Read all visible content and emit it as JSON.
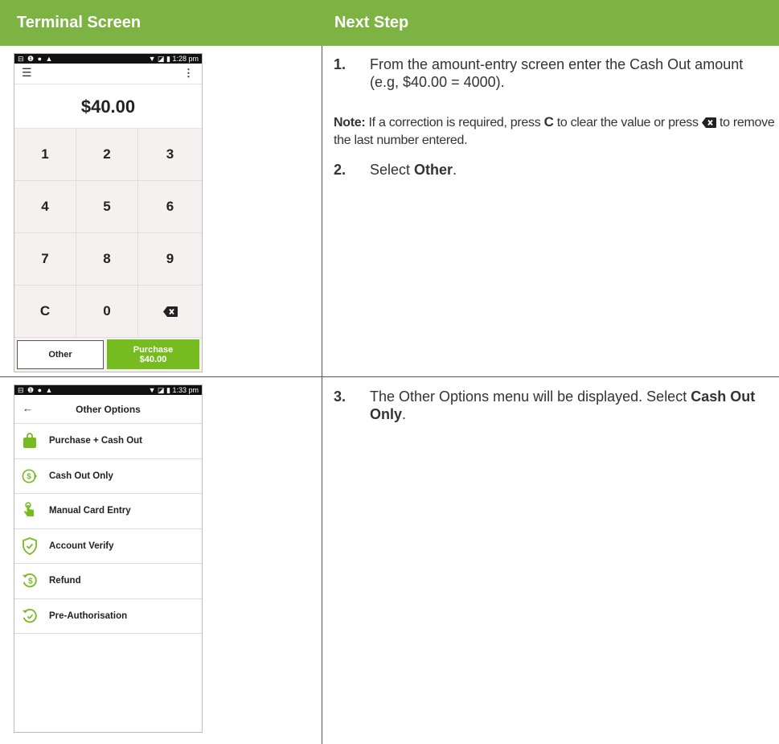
{
  "header": {
    "col1": "Terminal Screen",
    "col2": "Next Step"
  },
  "screen1": {
    "status_left": "⊟ ❶ ● ▲",
    "status_right": "▼ ◪ ▮ 1:28 pm",
    "menu_icon": "☰",
    "kebab_icon": "⋮",
    "amount": "$40.00",
    "keys": [
      "1",
      "2",
      "3",
      "4",
      "5",
      "6",
      "7",
      "8",
      "9",
      "C",
      "0",
      "⌫"
    ],
    "other_label": "Other",
    "purchase_label": "Purchase",
    "purchase_amount": "$40.00"
  },
  "screen2": {
    "status_left": "⊟ ❶ ● ▲",
    "status_right": "▼ ◪ ▮ 1:33 pm",
    "back_icon": "←",
    "title": "Other Options",
    "items": [
      {
        "label": "Purchase + Cash Out",
        "icon": "shopping-bag-icon"
      },
      {
        "label": "Cash Out Only",
        "icon": "cash-out-icon"
      },
      {
        "label": "Manual Card Entry",
        "icon": "touch-hand-icon"
      },
      {
        "label": "Account Verify",
        "icon": "shield-verify-icon"
      },
      {
        "label": "Refund",
        "icon": "refund-icon"
      },
      {
        "label": "Pre-Authorisation",
        "icon": "check-circle-icon"
      }
    ]
  },
  "steps": {
    "s1_num": "1.",
    "s1_text": "From the amount-entry screen enter the Cash Out amount (e.g, $40.00 = 4000).",
    "note_label": "Note:",
    "note_a": " If a correction is required, press ",
    "note_c": "C",
    "note_b": " to clear the value or press ",
    "note_c2": " to remove the last number entered.",
    "s2_num": "2.",
    "s2_pre": "Select ",
    "s2_bold": "Other",
    "s2_post": ".",
    "s3_num": "3.",
    "s3_pre": "The Other Options menu will be displayed. Select ",
    "s3_bold": "Cash Out Only",
    "s3_post": "."
  },
  "colors": {
    "accent_green": "#7cb342",
    "button_green": "#76bc21"
  }
}
